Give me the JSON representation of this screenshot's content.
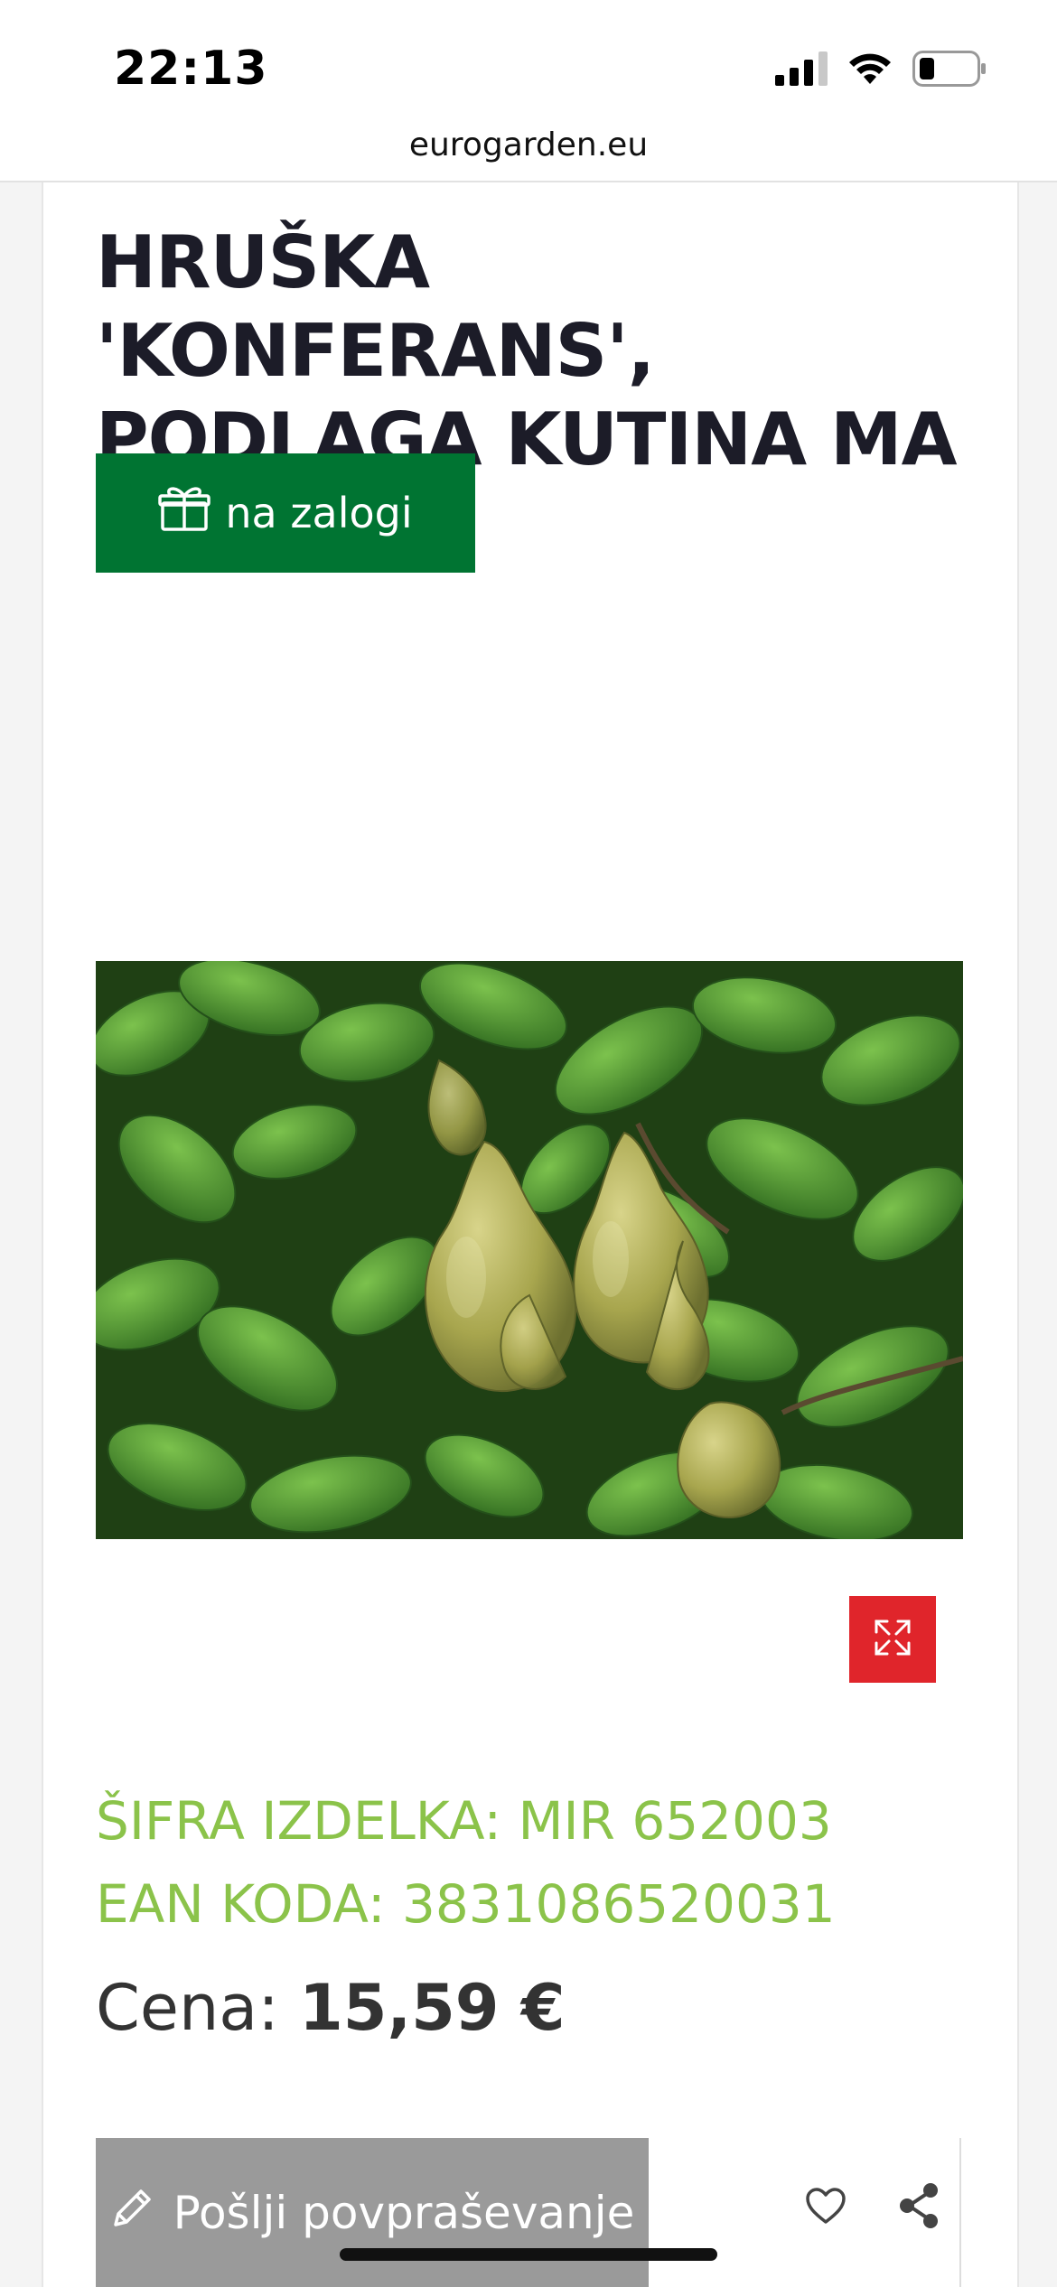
{
  "status_bar": {
    "time": "22:13",
    "icons": [
      "cellular-signal-icon",
      "wifi-icon",
      "battery-icon"
    ]
  },
  "browser": {
    "url": "eurogarden.eu"
  },
  "product": {
    "title": "HRUŠKA 'KONFERANS', PODLAGA KUTINA MA",
    "stock_label": "na zalogi",
    "stock_icon": "gift-box-icon",
    "image_alt": "pears",
    "sku": "ŠIFRA IZDELKA: MIR 652003",
    "ean": "EAN KODA: 3831086520031",
    "price_label": "Cena:",
    "price_value": "15,59 €"
  },
  "actions": {
    "inquiry_label": "Pošlji povpraševanje",
    "expand_icon": "expand-icon",
    "wishlist_icon": "heart-icon",
    "share_icon": "share-icon"
  },
  "colors": {
    "stock_green": "#007432",
    "code_green": "#8bc34a",
    "expand_red": "#e0252b",
    "inquiry_gray": "#9a9a9a"
  }
}
